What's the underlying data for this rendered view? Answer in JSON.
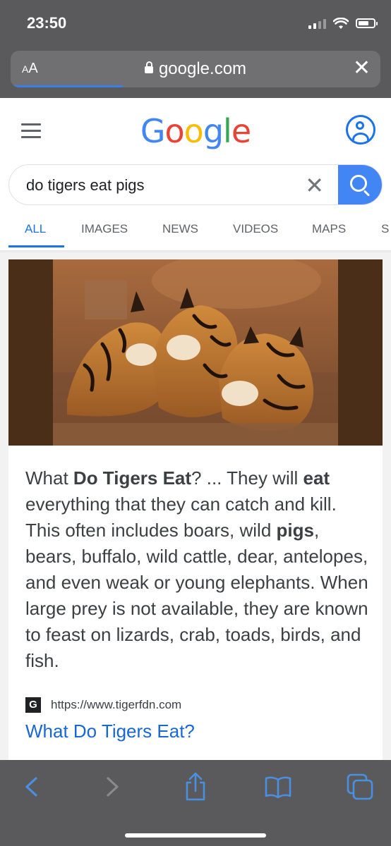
{
  "status_bar": {
    "time": "23:50",
    "icons": [
      "cellular-signal-icon",
      "wifi-icon",
      "battery-icon"
    ]
  },
  "browser": {
    "text_size_label": "AA",
    "url": "google.com",
    "close_icon": "close-icon"
  },
  "google": {
    "logo_text": "Google",
    "logo_colors": [
      "#4285F4",
      "#EA4335",
      "#FBBC05",
      "#4285F4",
      "#34A853",
      "#EA4335"
    ],
    "search": {
      "query": "do tigers eat pigs"
    },
    "tabs": [
      {
        "label": "ALL",
        "active": true
      },
      {
        "label": "IMAGES",
        "active": false
      },
      {
        "label": "NEWS",
        "active": false
      },
      {
        "label": "VIDEOS",
        "active": false
      },
      {
        "label": "MAPS",
        "active": false
      },
      {
        "label": "S",
        "active": false
      }
    ]
  },
  "result": {
    "snippet_parts": [
      {
        "text": "What ",
        "bold": false
      },
      {
        "text": "Do Tigers Eat",
        "bold": true
      },
      {
        "text": "? ... They will ",
        "bold": false
      },
      {
        "text": "eat",
        "bold": true
      },
      {
        "text": " everything that they can catch and kill. This often includes boars, wild ",
        "bold": false
      },
      {
        "text": "pigs",
        "bold": true
      },
      {
        "text": ", bears, buffalo, wild cattle, dear, antelopes, and even weak or young elephants. When large prey is not available, they are known to feast on lizards, crab, toads, birds, and fish.",
        "bold": false
      }
    ],
    "favicon_letter": "G",
    "source_url": "https://www.tigerfdn.com",
    "title": "What Do Tigers Eat?"
  },
  "toolbar": {
    "buttons": [
      "back-icon",
      "forward-icon",
      "share-icon",
      "bookmarks-icon",
      "tabs-icon"
    ]
  },
  "colors": {
    "chrome": "#5a5a5c",
    "accent_blue": "#1a73e8",
    "search_button": "#4285f4",
    "toolbar_icon_active": "#4a90e2",
    "toolbar_icon_disabled": "#8a8a8c"
  }
}
